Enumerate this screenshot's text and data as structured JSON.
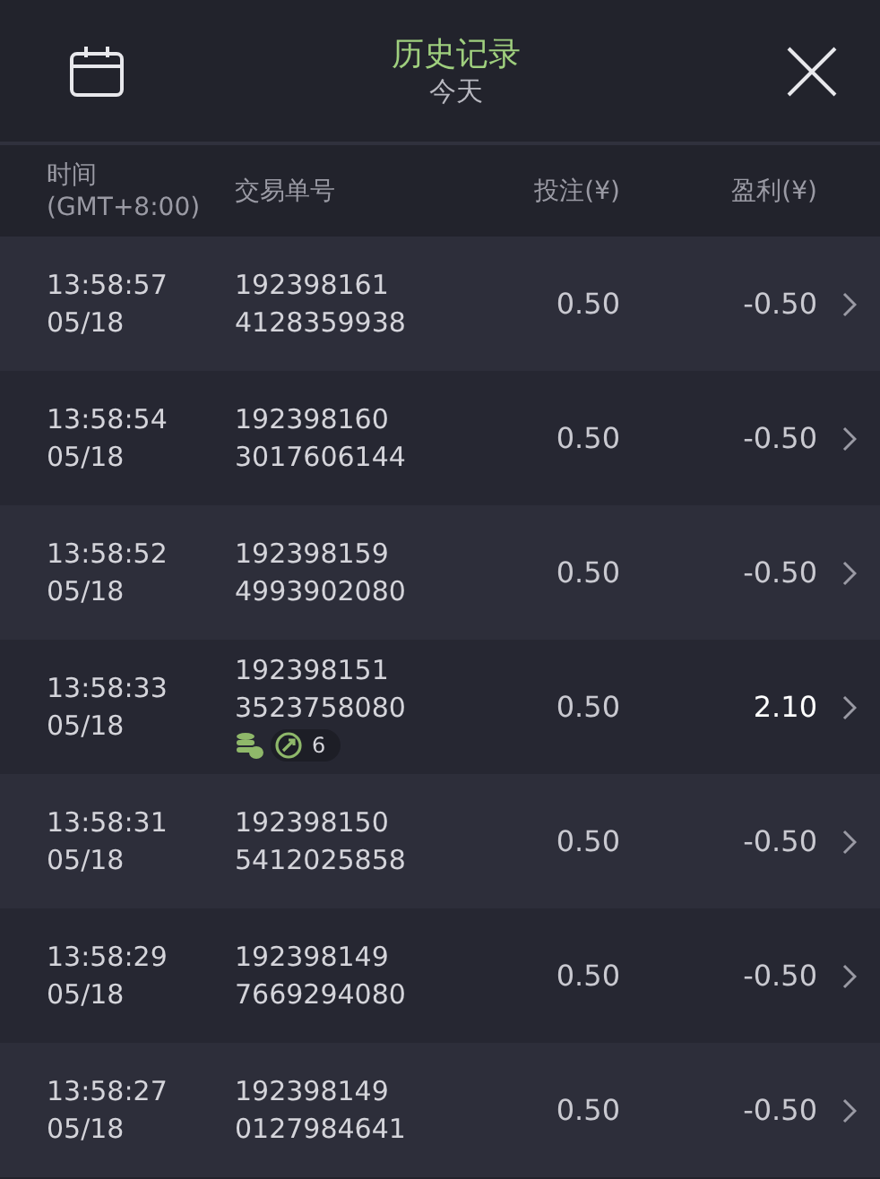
{
  "header": {
    "title": "历史记录",
    "subtitle": "今天"
  },
  "columns": [
    {
      "lines": [
        "时间",
        "(GMT+8:00)"
      ]
    },
    {
      "lines": [
        "交易单号"
      ]
    },
    {
      "lines": [
        "投注(¥)"
      ]
    },
    {
      "lines": [
        "盈利(¥)"
      ]
    }
  ],
  "rows": [
    {
      "time": "13:58:57",
      "date": "05/18",
      "order": [
        "192398161",
        "4128359938"
      ],
      "stake": "0.50",
      "profit": "-0.50",
      "win": false
    },
    {
      "time": "13:58:54",
      "date": "05/18",
      "order": [
        "192398160",
        "3017606144"
      ],
      "stake": "0.50",
      "profit": "-0.50",
      "win": false
    },
    {
      "time": "13:58:52",
      "date": "05/18",
      "order": [
        "192398159",
        "4993902080"
      ],
      "stake": "0.50",
      "profit": "-0.50",
      "win": false
    },
    {
      "time": "13:58:33",
      "date": "05/18",
      "order": [
        "192398151",
        "3523758080"
      ],
      "stake": "0.50",
      "profit": "2.10",
      "win": true,
      "badge": {
        "count": "6"
      }
    },
    {
      "time": "13:58:31",
      "date": "05/18",
      "order": [
        "192398150",
        "5412025858"
      ],
      "stake": "0.50",
      "profit": "-0.50",
      "win": false
    },
    {
      "time": "13:58:29",
      "date": "05/18",
      "order": [
        "192398149",
        "7669294080"
      ],
      "stake": "0.50",
      "profit": "-0.50",
      "win": false
    },
    {
      "time": "13:58:27",
      "date": "05/18",
      "order": [
        "192398149",
        "0127984641"
      ],
      "stake": "0.50",
      "profit": "-0.50",
      "win": false
    }
  ]
}
